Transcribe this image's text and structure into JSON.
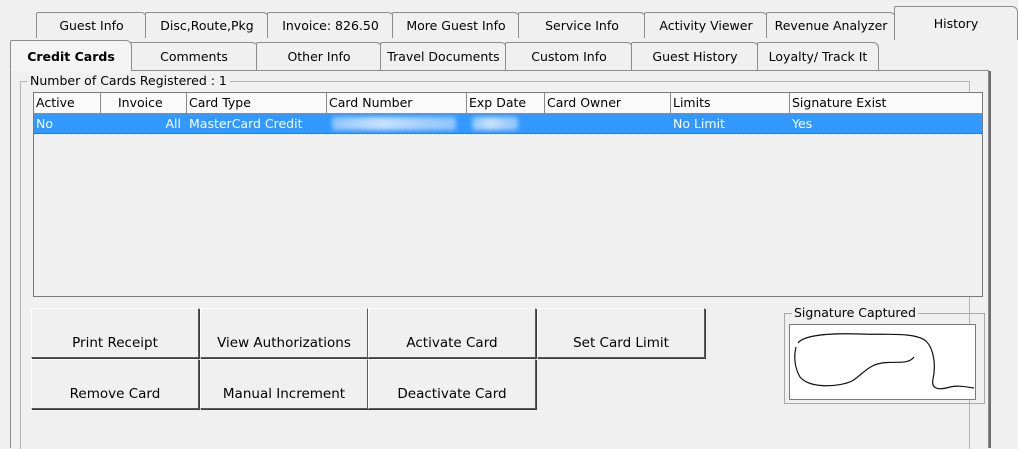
{
  "tabs_row1": [
    {
      "label": "Guest Info"
    },
    {
      "label": "Disc,Route,Pkg"
    },
    {
      "label": "Invoice: 826.50"
    },
    {
      "label": "More Guest Info"
    },
    {
      "label": "Service Info"
    },
    {
      "label": "Activity Viewer"
    },
    {
      "label": "Revenue Analyzer"
    },
    {
      "label": "History"
    }
  ],
  "tabs_row2": [
    {
      "label": "Credit Cards",
      "active": true
    },
    {
      "label": "Comments"
    },
    {
      "label": "Other Info"
    },
    {
      "label": "Travel Documents"
    },
    {
      "label": "Custom Info"
    },
    {
      "label": "Guest History"
    },
    {
      "label": "Loyalty/ Track It"
    }
  ],
  "cards_group": {
    "label": "Number of Cards Registered : 1"
  },
  "grid": {
    "columns": [
      "Active",
      "Invoice",
      "Card Type",
      "Card Number",
      "Exp Date",
      "Card Owner",
      "Limits",
      "Signature Exist"
    ],
    "rows": [
      {
        "active": "No",
        "invoice": "All",
        "card_type": "MasterCard Credit",
        "card_number": "",
        "exp_date": "",
        "card_owner": "",
        "limits": "No Limit",
        "signature_exist": "Yes"
      }
    ]
  },
  "buttons": {
    "print_receipt": "Print Receipt",
    "view_authorizations": "View Authorizations",
    "activate_card": "Activate Card",
    "set_card_limit": "Set Card Limit",
    "remove_card": "Remove Card",
    "manual_increment": "Manual Increment",
    "deactivate_card": "Deactivate Card"
  },
  "signature": {
    "label": "Signature Captured"
  },
  "colors": {
    "selection": "#3399ff",
    "background": "#f0f0f0"
  }
}
